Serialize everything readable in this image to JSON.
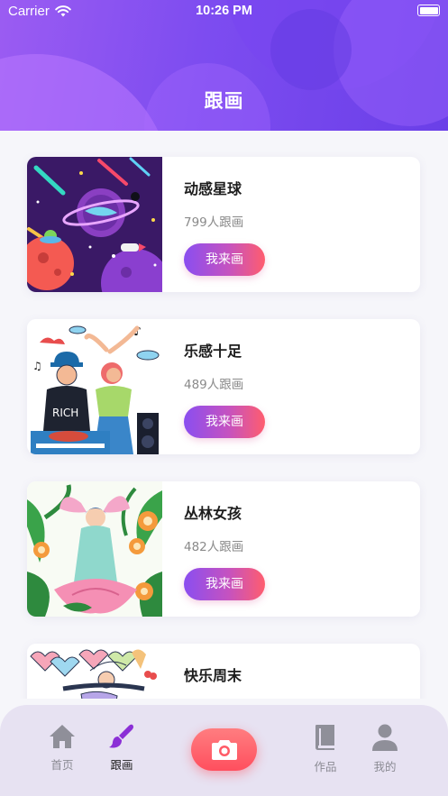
{
  "status_bar": {
    "carrier": "Carrier",
    "time": "10:26 PM"
  },
  "header": {
    "title": "跟画"
  },
  "cards": [
    {
      "title": "动感星球",
      "count": "799人跟画",
      "button": "我来画",
      "image": "space-planet-illustration"
    },
    {
      "title": "乐感十足",
      "count": "489人跟画",
      "button": "我来画",
      "image": "dj-music-illustration"
    },
    {
      "title": "丛林女孩",
      "count": "482人跟画",
      "button": "我来画",
      "image": "jungle-girl-illustration"
    },
    {
      "title": "快乐周末",
      "count": "",
      "button": "",
      "image": "happy-weekend-illustration"
    }
  ],
  "tabbar": {
    "home": {
      "label": "首页",
      "icon": "home-icon"
    },
    "follow": {
      "label": "跟画",
      "icon": "brush-icon"
    },
    "camera": {
      "icon": "camera-icon",
      "color": "#ff5a66"
    },
    "works": {
      "label": "作品",
      "icon": "book-icon"
    },
    "mine": {
      "label": "我的",
      "icon": "person-icon"
    }
  },
  "colors": {
    "header": "#7d4cf0",
    "active_tab": "#8b2fd6",
    "button_start": "#8a4ef0",
    "button_end": "#ff5d6e"
  }
}
